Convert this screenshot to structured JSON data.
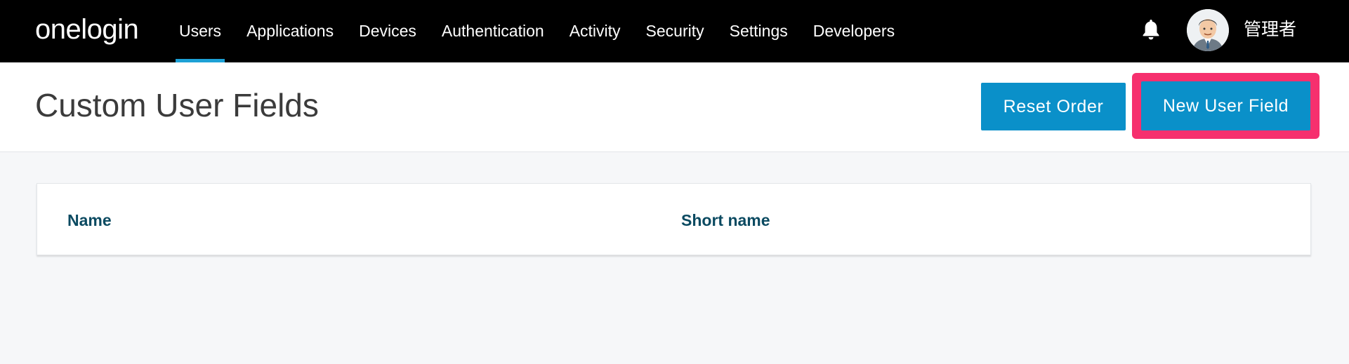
{
  "nav": {
    "logo": "onelogin",
    "items": [
      {
        "label": "Users",
        "active": true
      },
      {
        "label": "Applications"
      },
      {
        "label": "Devices"
      },
      {
        "label": "Authentication"
      },
      {
        "label": "Activity"
      },
      {
        "label": "Security"
      },
      {
        "label": "Settings"
      },
      {
        "label": "Developers"
      }
    ],
    "notifications_icon": "bell-icon",
    "avatar_icon": "user-avatar",
    "username": "管理者"
  },
  "header": {
    "title": "Custom User Fields",
    "reset_button": "Reset Order",
    "new_button": "New User Field"
  },
  "table": {
    "columns": [
      "Name",
      "Short name"
    ]
  },
  "colors": {
    "topbar": "#000000",
    "accent": "#1da1d6",
    "button": "#0a90c9",
    "highlight": "#f6306e",
    "column_header": "#0b4a61"
  }
}
